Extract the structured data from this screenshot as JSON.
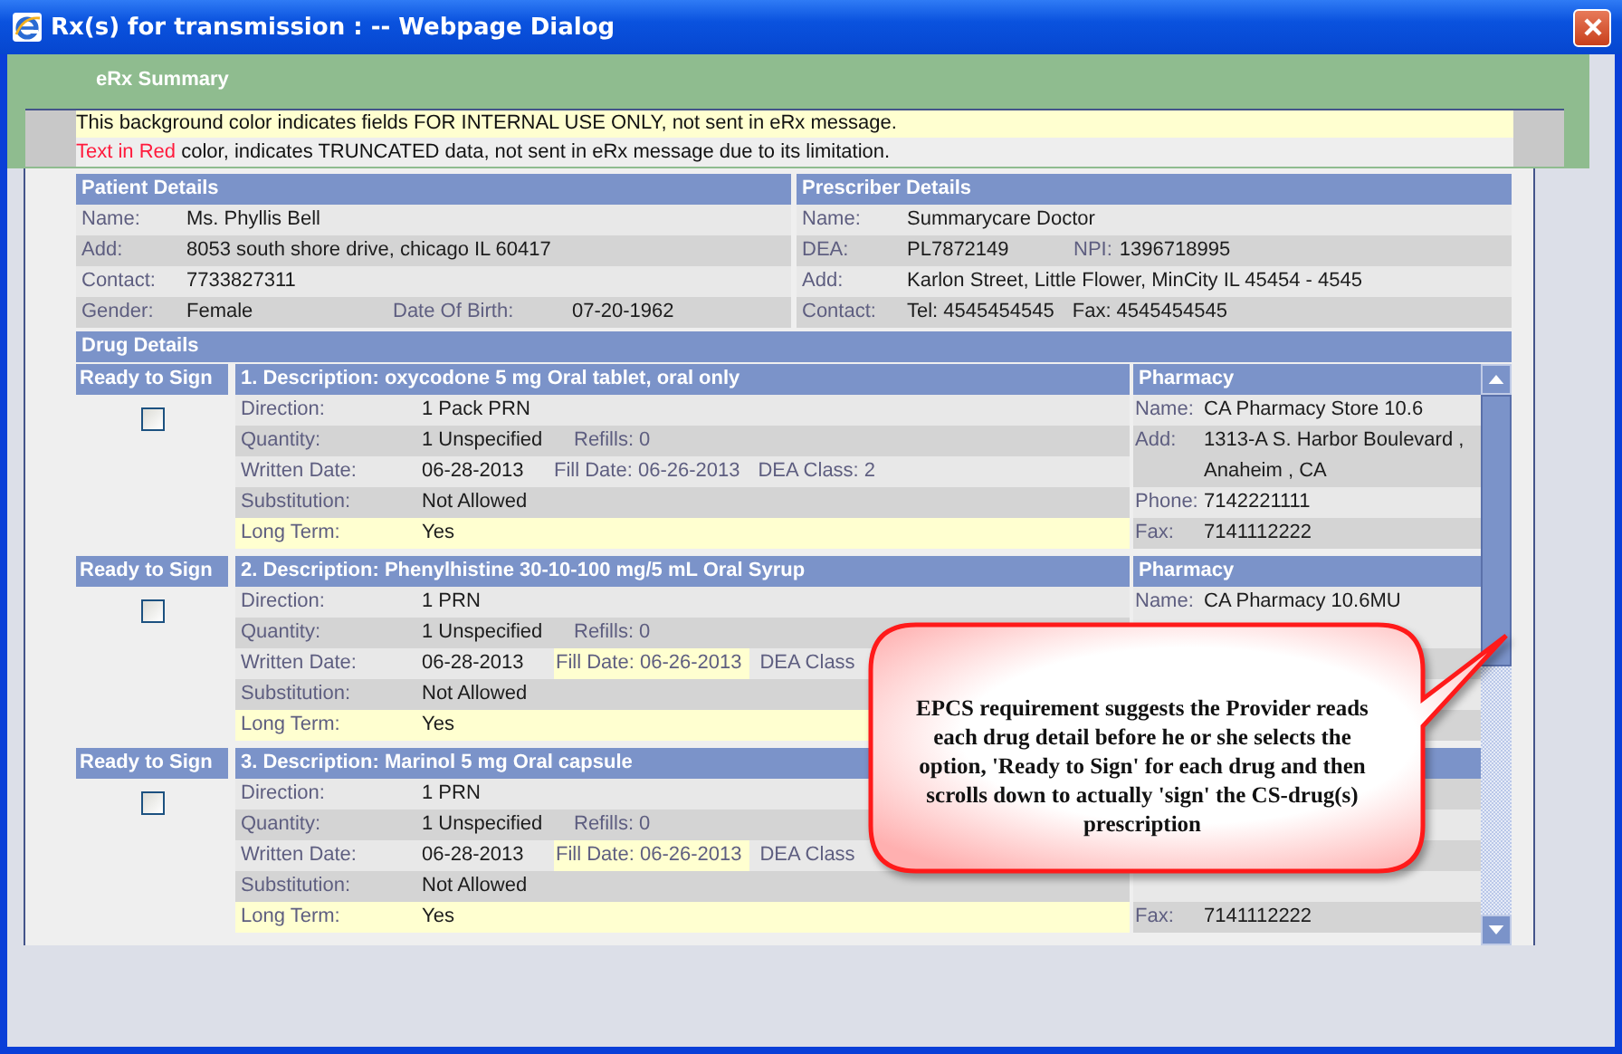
{
  "window": {
    "title": "Rx(s) for transmission : -- Webpage Dialog"
  },
  "section_title": "eRx Summary",
  "notice": {
    "internal_text": "This background color indicates fields FOR INTERNAL USE ONLY, not sent in eRx message.",
    "red_text": "Text in Red",
    "truncated_text": "color, indicates TRUNCATED data, not sent in eRx message due to its limitation."
  },
  "patient": {
    "title": "Patient Details",
    "rows": [
      {
        "label": "Name:",
        "value": "Ms. Phyllis Bell"
      },
      {
        "label": "Add:",
        "value": "8053 south shore drive, chicago IL 60417"
      },
      {
        "label": "Contact:",
        "value": "7733827311"
      },
      {
        "label": "Gender:",
        "value": "Female",
        "extra_label": "Date Of Birth:",
        "extra_value": "07-20-1962"
      }
    ]
  },
  "prescriber": {
    "title": "Prescriber Details",
    "rows": [
      {
        "label": "Name:",
        "value": "Summarycare Doctor"
      },
      {
        "label": "DEA:",
        "value": "PL7872149",
        "extra_label": "NPI:",
        "extra_value": "1396718995"
      },
      {
        "label": "Add:",
        "value": "Karlon Street, Little Flower, MinCity IL 45454 - 4545"
      },
      {
        "label": "Contact:",
        "value": "Tel: 4545454545",
        "extra_value": "Fax: 4545454545"
      }
    ]
  },
  "drug_details_title": "Drug Details",
  "drugs": [
    {
      "ready_label": "Ready to Sign",
      "checked": false,
      "description": "1. Description: oxycodone 5 mg Oral tablet, oral only",
      "direction": {
        "label": "Direction:",
        "value": "1 Pack PRN"
      },
      "quantity": {
        "label": "Quantity:",
        "value": "1 Unspecified",
        "refills": "Refills: 0"
      },
      "written": {
        "label": "Written Date:",
        "value": "06-28-2013",
        "fill_date": "Fill Date: 06-26-2013",
        "fill_internal": false,
        "dea_class": "DEA Class: 2"
      },
      "substitution": {
        "label": "Substitution:",
        "value": "Not Allowed"
      },
      "long_term": {
        "label": "Long Term:",
        "value": "Yes"
      },
      "pharmacy": {
        "title": "Pharmacy",
        "rows": [
          {
            "label": "Name:",
            "value": "CA Pharmacy Store 10.6"
          },
          {
            "label": "Add:",
            "value": "1313-A S. Harbor Boulevard , Anaheim , CA"
          },
          {
            "label": "Phone:",
            "value": "7142221111"
          },
          {
            "label": "Fax:",
            "value": "7141112222"
          }
        ]
      }
    },
    {
      "ready_label": "Ready to Sign",
      "checked": false,
      "description": "2. Description: Phenylhistine 30-10-100 mg/5 mL Oral Syrup",
      "direction": {
        "label": "Direction:",
        "value": "1 PRN"
      },
      "quantity": {
        "label": "Quantity:",
        "value": "1 Unspecified",
        "refills": "Refills: 0"
      },
      "written": {
        "label": "Written Date:",
        "value": "06-28-2013",
        "fill_date": "Fill Date: 06-26-2013",
        "fill_internal": true,
        "dea_class": "DEA Class"
      },
      "substitution": {
        "label": "Substitution:",
        "value": "Not Allowed"
      },
      "long_term": {
        "label": "Long Term:",
        "value": "Yes"
      },
      "pharmacy": {
        "title": "Pharmacy",
        "rows": [
          {
            "label": "Name:",
            "value": "CA Pharmacy 10.6MU"
          }
        ]
      }
    },
    {
      "ready_label": "Ready to Sign",
      "checked": false,
      "description": "3. Description: Marinol 5 mg Oral capsule",
      "direction": {
        "label": "Direction:",
        "value": "1 PRN"
      },
      "quantity": {
        "label": "Quantity:",
        "value": "1 Unspecified",
        "refills": "Refills: 0"
      },
      "written": {
        "label": "Written Date:",
        "value": "06-28-2013",
        "fill_date": "Fill Date: 06-26-2013",
        "fill_internal": true,
        "dea_class": "DEA Class"
      },
      "substitution": {
        "label": "Substitution:",
        "value": "Not Allowed"
      },
      "long_term": {
        "label": "Long Term:",
        "value": "Yes"
      },
      "pharmacy": {
        "rows": [
          {
            "label": "Fax:",
            "value": "7141112222"
          }
        ]
      }
    }
  ],
  "callout": {
    "text": "EPCS requirement suggests the Provider reads each drug detail before he or she selects the option, 'Ready to Sign' for each drug and then scrolls down to actually 'sign' the CS-drug(s) prescription"
  }
}
